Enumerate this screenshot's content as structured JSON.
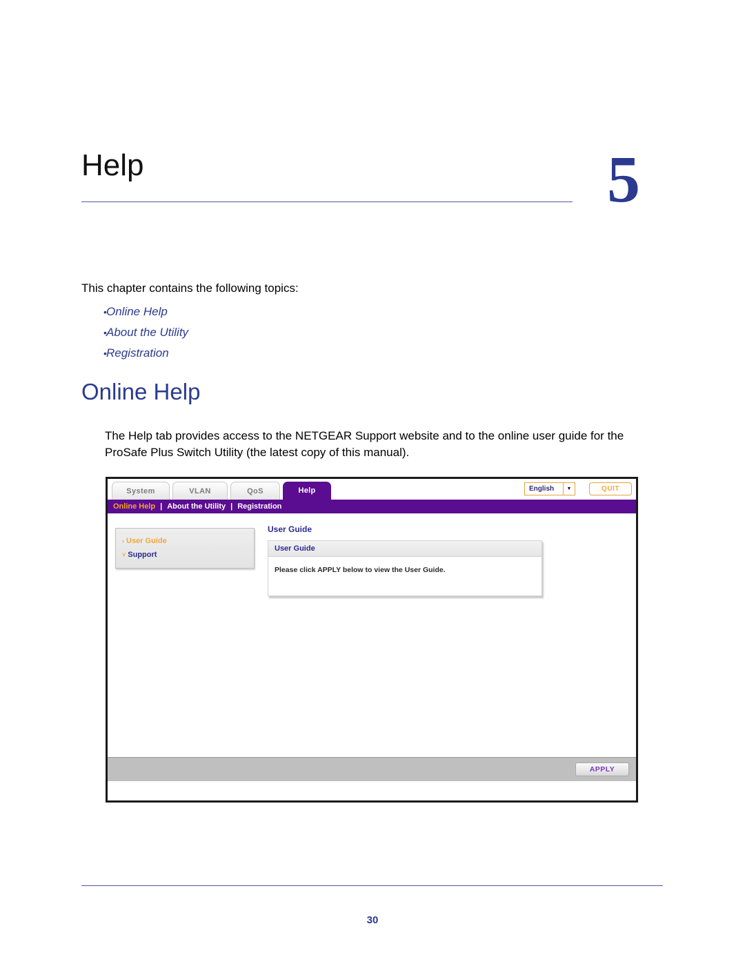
{
  "page": {
    "chapter_title": "Help",
    "chapter_number": "5",
    "intro": "This chapter contains the following topics:",
    "topics": [
      {
        "bullet": "•",
        "label": "Online Help"
      },
      {
        "bullet": "•",
        "label": "About the Utility"
      },
      {
        "bullet": "•",
        "label": "Registration"
      }
    ],
    "section_heading": "Online Help",
    "body_paragraph": "The Help tab provides access to the NETGEAR Support website and to the online user guide for the ProSafe Plus Switch Utility (the latest copy of this manual).",
    "page_number": "30"
  },
  "app": {
    "tabs": [
      {
        "label": "System",
        "active": false
      },
      {
        "label": "VLAN",
        "active": false
      },
      {
        "label": "QoS",
        "active": false
      },
      {
        "label": "Help",
        "active": true
      }
    ],
    "language": {
      "value": "English",
      "caret": "▼"
    },
    "quit_label": "QUIT",
    "sub_nav": [
      {
        "label": "Online Help",
        "active": true
      },
      {
        "label": "About the Utility",
        "active": false
      },
      {
        "label": "Registration",
        "active": false
      }
    ],
    "sub_nav_separator": "|",
    "side_menu": [
      {
        "arrow": "›",
        "label": "User Guide",
        "selected": true
      },
      {
        "arrow": "˅",
        "label": "Support",
        "selected": false
      }
    ],
    "content": {
      "title": "User Guide",
      "panel_header": "User Guide",
      "panel_message": "Please click APPLY below to view the User Guide."
    },
    "apply_label": "APPLY"
  },
  "colors": {
    "brand_purple": "#5B0D91",
    "accent_orange": "#F5A623",
    "heading_blue": "#2B3A8F",
    "link_blue": "#2b2b8f"
  }
}
